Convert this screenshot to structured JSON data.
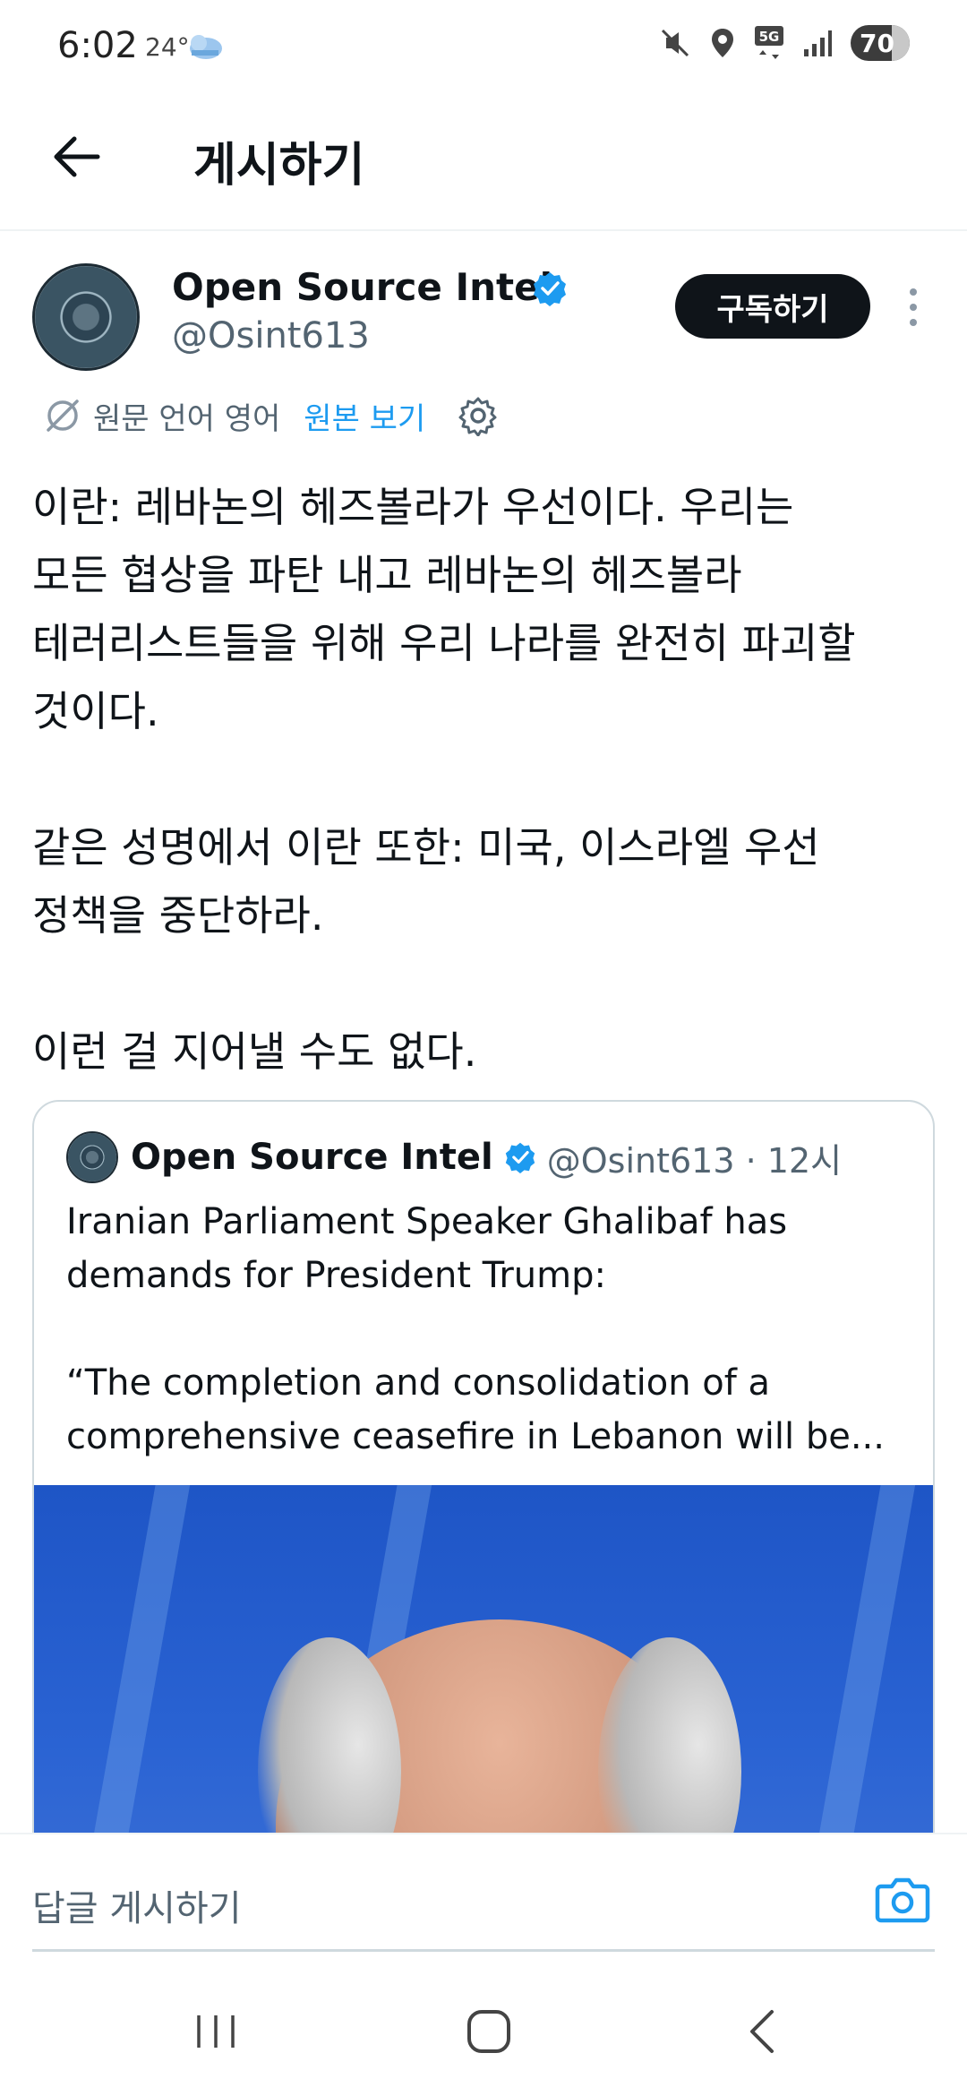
{
  "status_bar": {
    "time": "6:02",
    "temperature": "24°",
    "network": "5G",
    "battery": "70",
    "icons": [
      "mute-icon",
      "location-icon",
      "5g-icon",
      "signal-icon",
      "battery-icon"
    ]
  },
  "header": {
    "title": "게시하기",
    "back_icon": "arrow-left-icon"
  },
  "post": {
    "author": {
      "name": "Open Source Intel",
      "handle": "@Osint613",
      "verified": true
    },
    "subscribe_label": "구독하기",
    "translation": {
      "label": "원문 언어 영어",
      "link": "원본 보기"
    },
    "paragraphs": [
      "이란: 레바논의 헤즈볼라가 우선이다. 우리는\n모든 협상을 파탄 내고 레바논의 헤즈볼라\n테러리스트들을 위해 우리 나라를 완전히 파괴할\n것이다.",
      "같은 성명에서 이란 또한: 미국, 이스라엘 우선\n정책을 중단하라.",
      "이런 걸 지어낼 수도 없다."
    ]
  },
  "quoted": {
    "author_name": "Open Source Intel",
    "meta": "@Osint613 · 12시",
    "lines": [
      "Iranian Parliament Speaker Ghalibaf has",
      "demands for President Trump:",
      "“The completion and consolidation of a",
      "comprehensive ceasefire in Lebanon will be..."
    ]
  },
  "reply": {
    "placeholder": "답글 게시하기"
  },
  "colors": {
    "accent": "#1d9bf0",
    "text": "#0f1419",
    "muted": "#536471",
    "button_bg": "#0f1419"
  }
}
